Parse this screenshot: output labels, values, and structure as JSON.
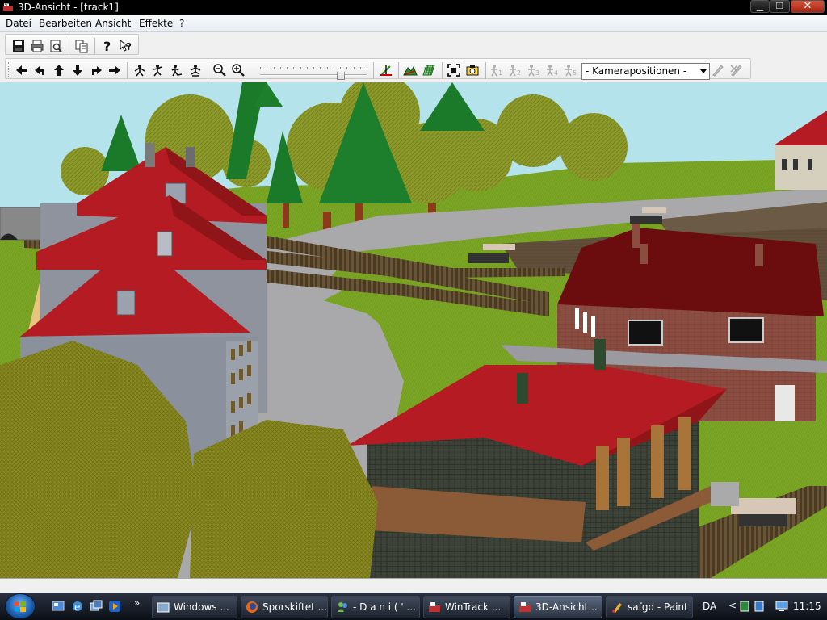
{
  "window": {
    "title": "3D-Ansicht - [track1]",
    "min_label": "▁",
    "max_label": "❐",
    "close_label": "✕"
  },
  "menu": {
    "items": [
      "Datei",
      "Bearbeiten",
      "Ansicht",
      "Effekte",
      "?"
    ]
  },
  "toolbar": {
    "camera_select_value": "- Kamerapositionen -",
    "zoom_level_fraction": 0.78
  },
  "viewport": {
    "description_colors": {
      "sky": "#b5e3ec",
      "grass": "#7aa624",
      "roof_red": "#b51b22",
      "road": "#a9a9ab"
    }
  },
  "taskbar": {
    "buttons": [
      {
        "label": "Windows ...",
        "icon": "explorer-icon"
      },
      {
        "label": "Sporskiftet ...",
        "icon": "firefox-icon"
      },
      {
        "label": "- D a n i ( ' ...",
        "icon": "messenger-icon"
      },
      {
        "label": "WinTrack ...",
        "icon": "wintrack-icon"
      },
      {
        "label": "3D-Ansicht...",
        "icon": "wintrack-icon"
      },
      {
        "label": "safgd - Paint",
        "icon": "paint-icon"
      }
    ],
    "language": "DA",
    "clock": "11:15"
  }
}
